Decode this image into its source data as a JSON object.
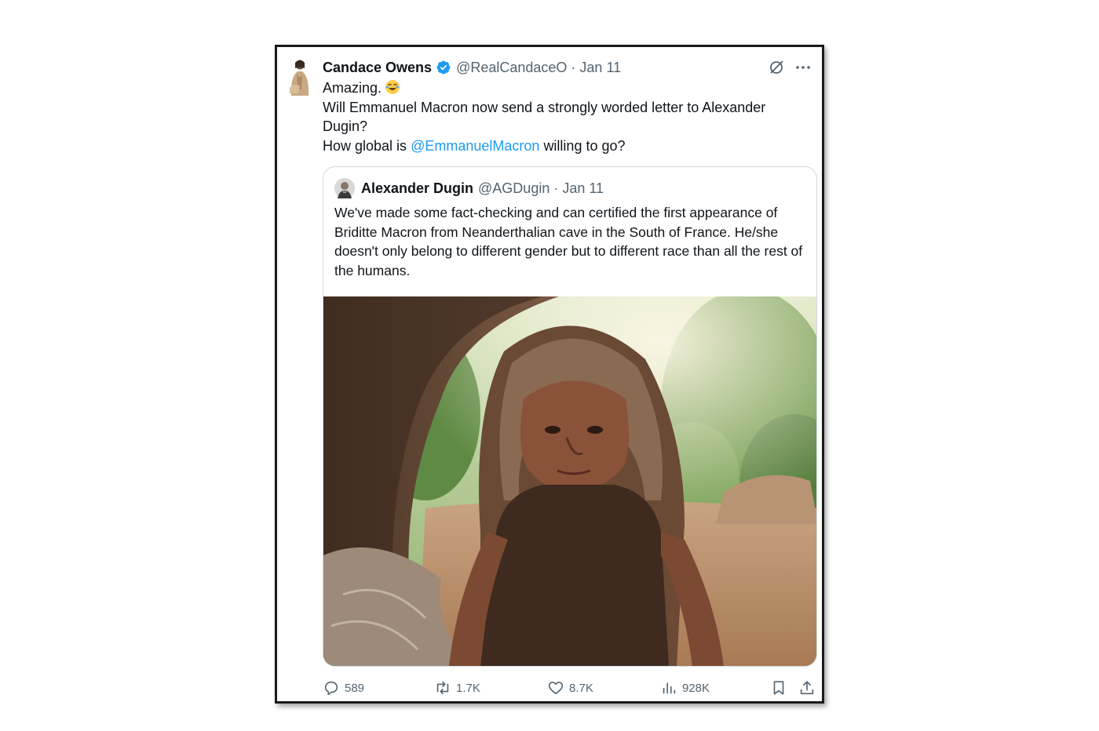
{
  "tweet": {
    "author_name": "Candace Owens",
    "handle": "@RealCandaceO",
    "separator": "·",
    "date": "Jan 11",
    "lines": [
      "Amazing.",
      "Will Emmanuel Macron now send a strongly worded letter to Alexander Dugin?"
    ],
    "line3_prefix": "How global is",
    "mention": "@EmmanuelMacron",
    "line3_suffix": "willing to go?"
  },
  "quote": {
    "author_name": "Alexander Dugin",
    "handle": "@AGDugin",
    "separator": "·",
    "date": "Jan 11",
    "text": "We've made some fact-checking and can certified the first appearance of Briditte Macron from Neanderthalian cave in the South of France. He/she doesn't only belong to different gender but to different race than all the rest of the humans."
  },
  "actions": {
    "replies": "589",
    "reposts": "1.7K",
    "likes": "8.7K",
    "views": "928K"
  },
  "icons": {
    "verified": "verified-badge-icon",
    "grok": "grok-icon",
    "more": "more-icon",
    "reply": "reply-icon",
    "repost": "repost-icon",
    "like": "heart-icon",
    "views": "views-icon",
    "bookmark": "bookmark-icon",
    "share": "share-icon",
    "emoji": "laughing-emoji-icon"
  },
  "colors": {
    "link": "#1d9bf0",
    "text": "#0f1419",
    "secondary": "#536471"
  }
}
